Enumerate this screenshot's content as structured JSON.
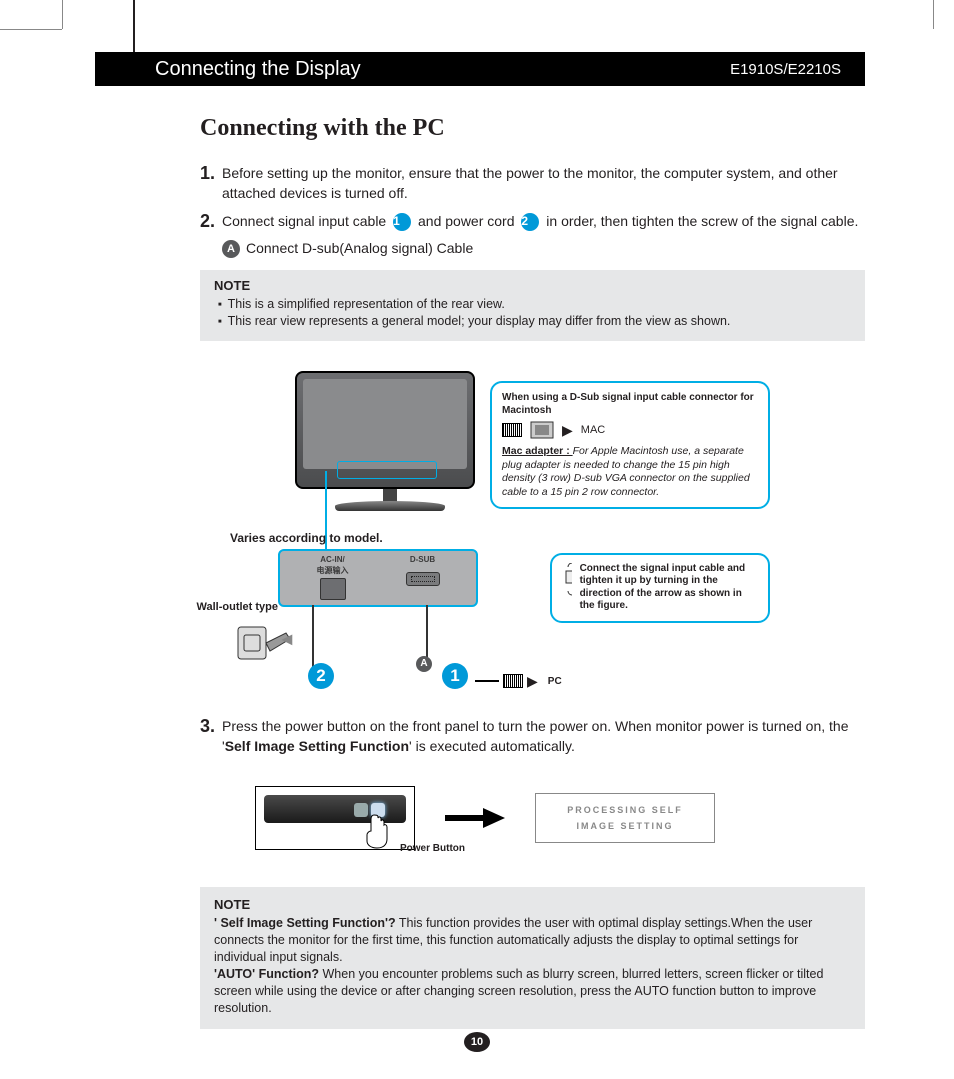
{
  "header": {
    "title": "Connecting the Display",
    "model": "E1910S/E2210S"
  },
  "section_title": "Connecting with the PC",
  "steps": {
    "s1": {
      "num": "1.",
      "text": "Before setting up the monitor, ensure that the power to the monitor, the computer system, and other attached devices is turned off."
    },
    "s2": {
      "num": "2.",
      "text_a": "Connect signal input cable ",
      "text_b": " and power cord ",
      "text_c": " in order, then tighten the screw of the signal cable.",
      "sub_A": "Connect D-sub(Analog signal) Cable"
    },
    "s3": {
      "num": "3.",
      "text_a": "Press the power button on the front panel to turn the power on. When monitor power is turned on, the '",
      "bold": "Self Image Setting Function",
      "text_b": "' is executed automatically."
    }
  },
  "badges": {
    "one": "1",
    "two": "2",
    "A": "A"
  },
  "note1": {
    "title": "NOTE",
    "items": [
      "This is a simplified representation of the rear view.",
      "This rear view represents a general model; your display may differ from the view as shown."
    ]
  },
  "diagram": {
    "varies_label": "Varies according to model.",
    "wall_label": "Wall-outlet type",
    "ports": {
      "acin_line1": "AC-IN/",
      "acin_line2": "电源输入",
      "dsub": "D-SUB"
    },
    "pc_label": "PC",
    "mac_box": {
      "title": "When using a D-Sub signal input cable connector for Macintosh",
      "mac_label": "MAC",
      "adapter_title": "Mac adapter : ",
      "adapter_text": "For Apple Macintosh use, a separate plug adapter is needed to change the 15 pin high density (3 row) D-sub VGA connector on the supplied cable to a 15 pin  2 row connector."
    },
    "tighten_box": {
      "text": "Connect the signal input cable and tighten it up by turning in the direction of the arrow as shown in the figure."
    },
    "power_button_label": "Power Button",
    "processing_line1": "PROCESSING SELF",
    "processing_line2": "IMAGE SETTING"
  },
  "note2": {
    "title": "NOTE",
    "q1_label": "' Self Image Setting Function'?",
    "q1_text": " This function provides the user with optimal display settings.When the user connects the monitor for the first time, this function automatically adjusts the display to optimal settings for individual input signals.",
    "q2_label": "'AUTO' Function?",
    "q2_text": " When you encounter problems such as blurry screen, blurred letters, screen flicker or tilted screen while using the device or after changing screen resolution, press the AUTO function button to improve resolution."
  },
  "page_number": "10"
}
